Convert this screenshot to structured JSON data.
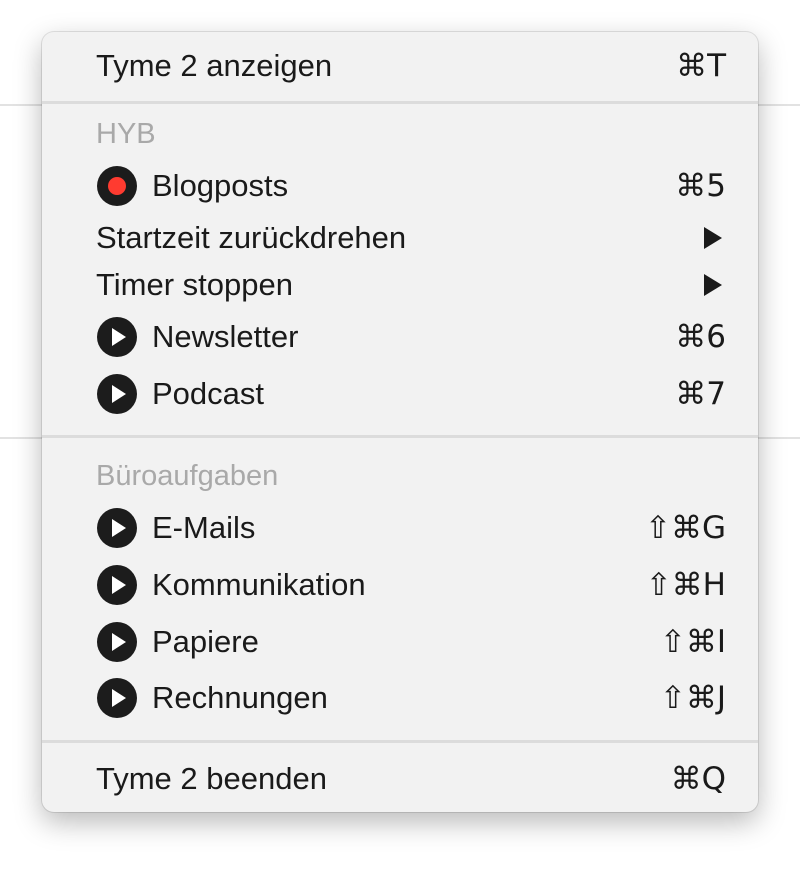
{
  "menu": {
    "show": {
      "label": "Tyme 2 anzeigen",
      "shortcut": "⌘T"
    },
    "groups": [
      {
        "header": "HYB",
        "items": [
          {
            "label": "Blogposts",
            "shortcut": "⌘5",
            "icon": "record-icon",
            "status": "running",
            "color": "#ff3b30"
          },
          {
            "label": "Startzeit zurückdrehen",
            "submenu": true
          },
          {
            "label": "Timer stoppen",
            "submenu": true
          },
          {
            "label": "Newsletter",
            "shortcut": "⌘6",
            "icon": "play-icon"
          },
          {
            "label": "Podcast",
            "shortcut": "⌘7",
            "icon": "play-icon"
          }
        ]
      },
      {
        "header": "Büroaufgaben",
        "items": [
          {
            "label": "E-Mails",
            "shortcut": "⇧⌘G",
            "icon": "play-icon"
          },
          {
            "label": "Kommunikation",
            "shortcut": "⇧⌘H",
            "icon": "play-icon"
          },
          {
            "label": "Papiere",
            "shortcut": "⇧⌘I",
            "icon": "play-icon"
          },
          {
            "label": "Rechnungen",
            "shortcut": "⇧⌘J",
            "icon": "play-icon"
          }
        ]
      }
    ],
    "quit": {
      "label": "Tyme 2 beenden",
      "shortcut": "⌘Q"
    }
  }
}
